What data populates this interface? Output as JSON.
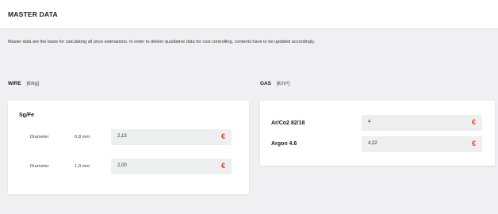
{
  "page": {
    "title": "MASTER DATA",
    "description": "Master data are the basis for calculating all price estimations. In order to deliver qualitative data for cost controlling, contents have to be updated accordingly."
  },
  "wire": {
    "heading": "WIRE",
    "unit": "[€/kg]",
    "group_title": "Sg/Fe",
    "rows": [
      {
        "label": "Diameter",
        "size": "0,8 mm",
        "value": "2,13",
        "currency": "€"
      },
      {
        "label": "Diameter",
        "size": "1,0 mm",
        "value": "2,00",
        "currency": "€"
      }
    ]
  },
  "gas": {
    "heading": "GAS",
    "unit": "[€/m³]",
    "rows": [
      {
        "label": "Ar/Co2 82/18",
        "value": "4",
        "currency": "€"
      },
      {
        "label": "Argon 4.6",
        "value": "4,22",
        "currency": "€"
      }
    ]
  },
  "colors": {
    "accent": "#e8431c",
    "input_bg": "#eeeff1",
    "page_bg": "#f0f0f2"
  }
}
